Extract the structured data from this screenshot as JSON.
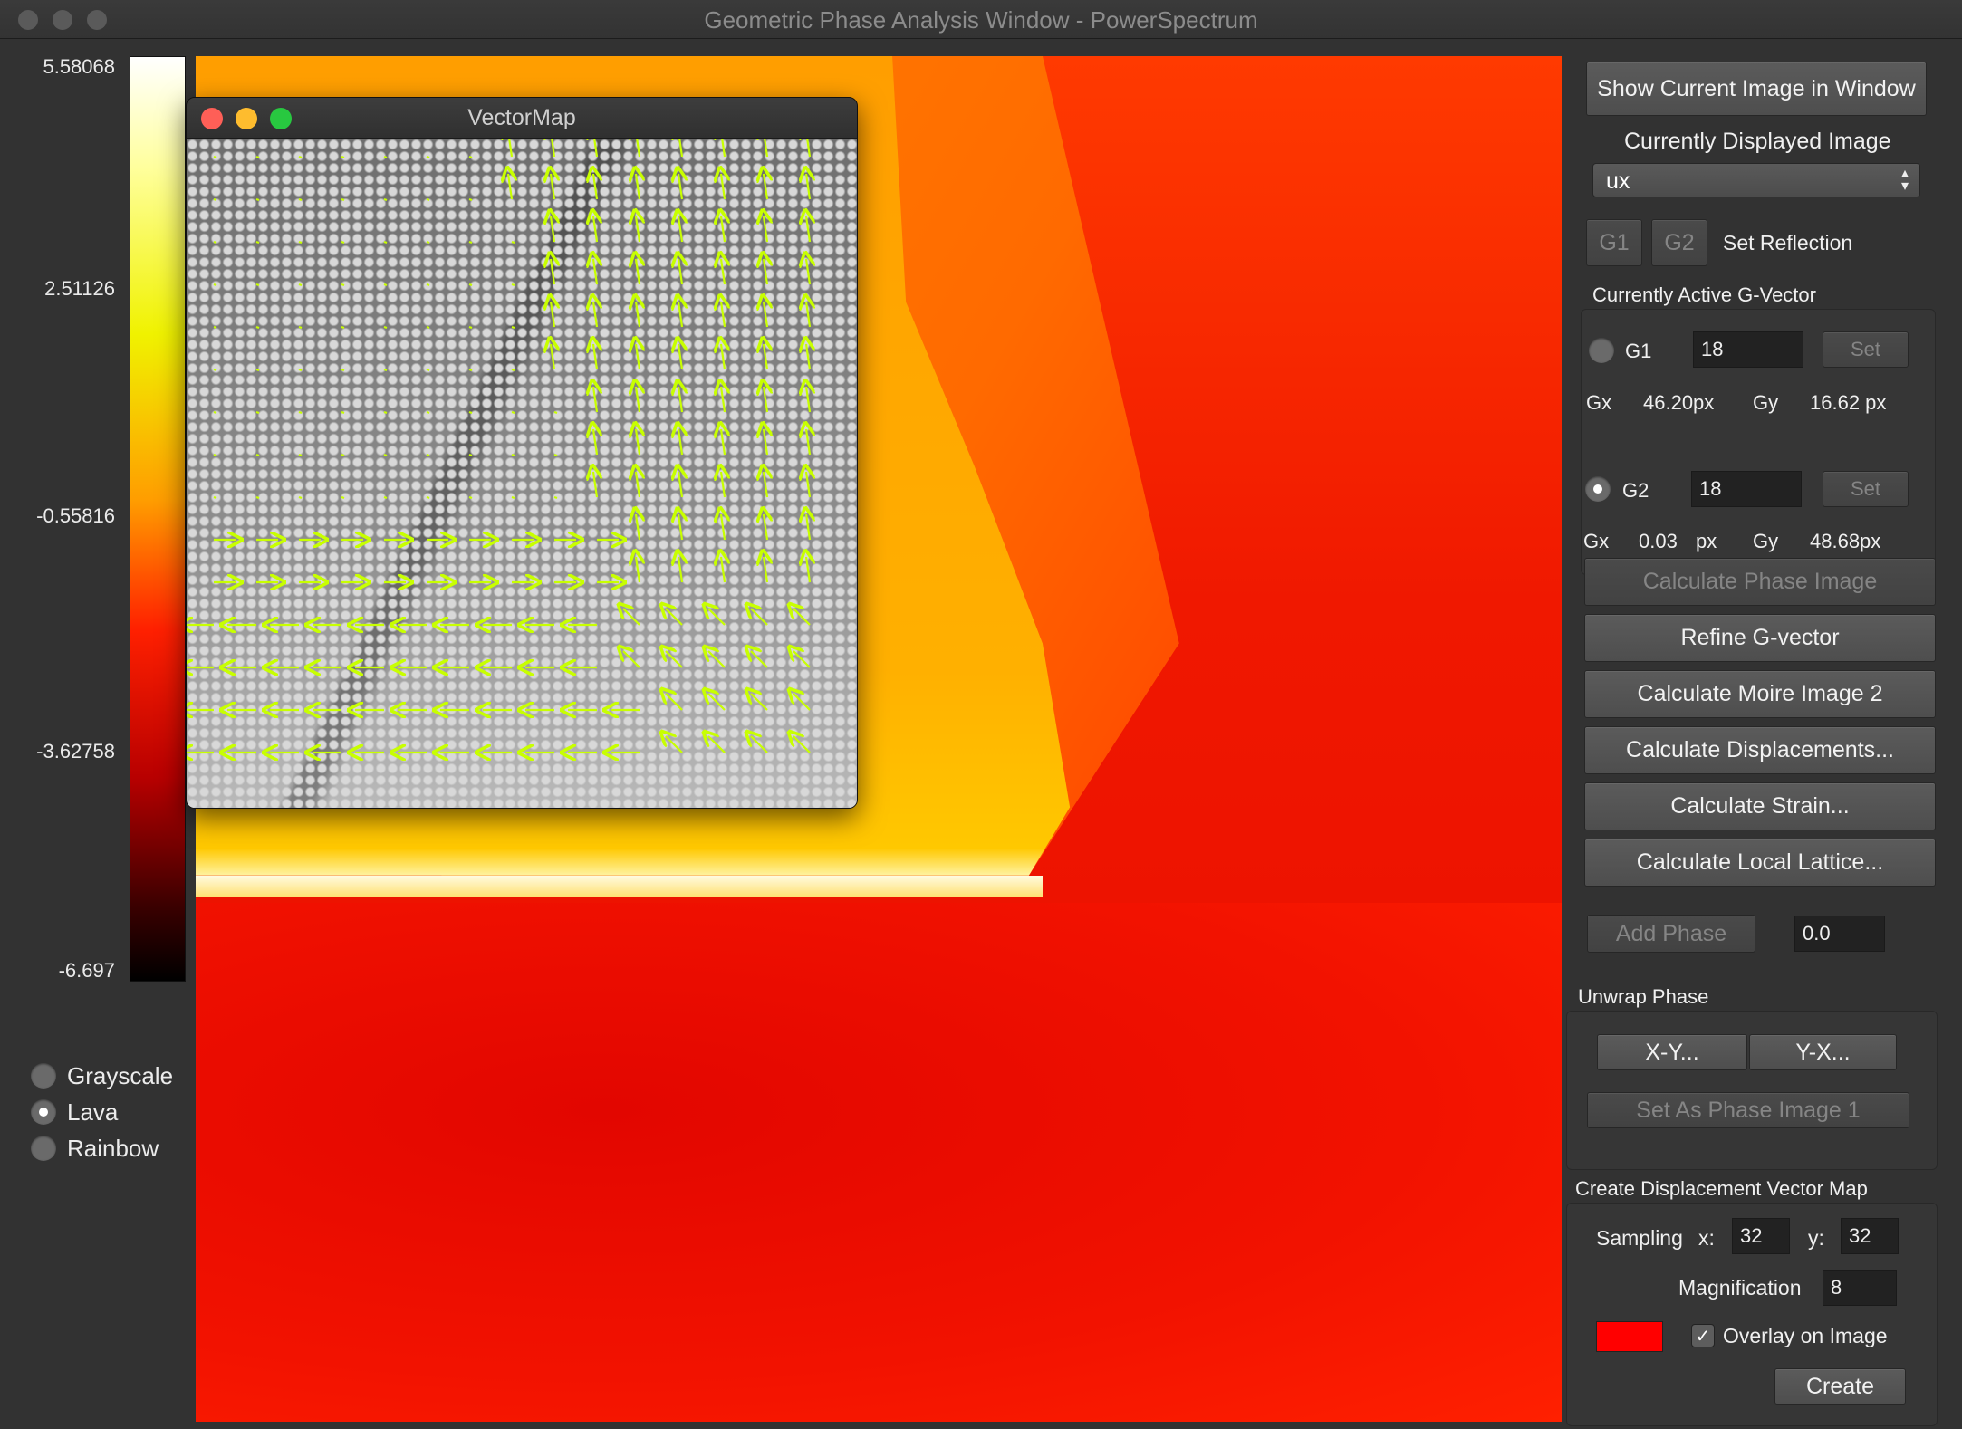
{
  "window": {
    "title": "Geometric Phase Analysis Window - PowerSpectrum"
  },
  "colorbar": {
    "labels": [
      "5.58068",
      "2.51126",
      "-0.55816",
      "-3.62758",
      "-6.697"
    ]
  },
  "colormaps": [
    {
      "label": "Grayscale",
      "selected": false
    },
    {
      "label": "Lava",
      "selected": true
    },
    {
      "label": "Rainbow",
      "selected": false
    }
  ],
  "vector_window": {
    "title": "VectorMap"
  },
  "panel": {
    "show_current_button": "Show Current Image in Window",
    "currently_displayed_label": "Currently Displayed Image",
    "displayed_image_value": "ux",
    "g1_button": "G1",
    "g2_button": "G2",
    "set_reflection_label": "Set Reflection",
    "active_gvector_label": "Currently Active G-Vector",
    "g1": {
      "label": "G1",
      "value": "18",
      "set_label": "Set",
      "gx_label": "Gx",
      "gx_value": "46.20px",
      "gy_label": "Gy",
      "gy_value": "16.62 px"
    },
    "g2": {
      "label": "G2",
      "value": "18",
      "set_label": "Set",
      "gx_label": "Gx",
      "gx_value": "0.03",
      "gx_unit": "px",
      "gy_label": "Gy",
      "gy_value": "48.68px"
    },
    "buttons": {
      "calc_phase": "Calculate Phase Image",
      "refine": "Refine G-vector",
      "moire": "Calculate Moire Image 2",
      "displacements": "Calculate Displacements...",
      "strain": "Calculate Strain...",
      "lattice": "Calculate Local Lattice..."
    },
    "add_phase_button": "Add Phase",
    "add_phase_value": "0.0",
    "unwrap_label": "Unwrap Phase",
    "xy_button": "X-Y...",
    "yx_button": "Y-X...",
    "set_phase1_button": "Set As Phase Image 1",
    "dvm_label": "Create Displacement Vector Map",
    "sampling_label": "Sampling",
    "x_label": "x:",
    "x_value": "32",
    "y_label": "y:",
    "y_value": "32",
    "magnification_label": "Magnification",
    "magnification_value": "8",
    "overlay_label": "Overlay on Image",
    "overlay_checked": true,
    "vector_color": "#ff0000",
    "create_button": "Create"
  }
}
